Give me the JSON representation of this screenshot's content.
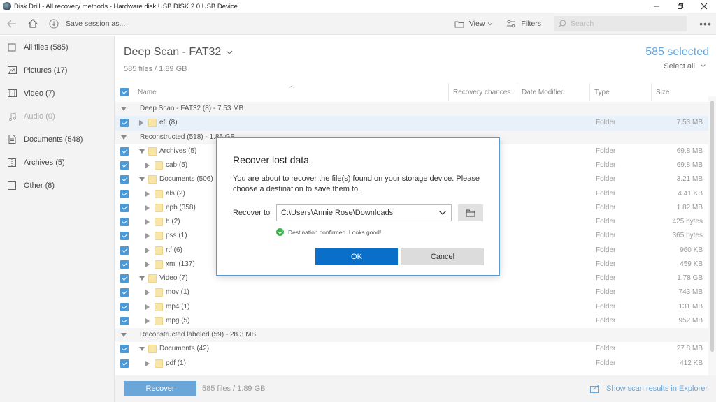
{
  "window": {
    "title": "Disk Drill - All recovery methods - Hardware disk USB DISK 2.0 USB Device",
    "controls": [
      "minimize",
      "maximize",
      "close"
    ]
  },
  "toolbar": {
    "save_session": "Save session as...",
    "view": "View",
    "filters": "Filters",
    "search_placeholder": "Search"
  },
  "sidebar": {
    "items": [
      {
        "label": "All files (585)",
        "icon": "file-icon",
        "state": "active"
      },
      {
        "label": "Pictures (17)",
        "icon": "picture-icon",
        "state": "normal"
      },
      {
        "label": "Video (7)",
        "icon": "video-icon",
        "state": "normal"
      },
      {
        "label": "Audio (0)",
        "icon": "audio-icon",
        "state": "disabled"
      },
      {
        "label": "Documents (548)",
        "icon": "document-icon",
        "state": "normal"
      },
      {
        "label": "Archives (5)",
        "icon": "archive-icon",
        "state": "normal"
      },
      {
        "label": "Other (8)",
        "icon": "other-icon",
        "state": "normal"
      }
    ]
  },
  "main": {
    "title": "Deep Scan - FAT32",
    "subtitle": "585 files / 1.89 GB",
    "selected": "585 selected",
    "select_all": "Select all"
  },
  "table": {
    "columns": [
      "Name",
      "Recovery chances",
      "Date Modified",
      "Type",
      "Size"
    ],
    "rows": [
      {
        "kind": "group",
        "name": "Deep Scan - FAT32 (8) - 7.53 MB"
      },
      {
        "kind": "item",
        "level": 1,
        "expander": "right",
        "name": "efi (8)",
        "type": "Folder",
        "size": "7.53 MB",
        "highlight": true
      },
      {
        "kind": "group",
        "name": "Reconstructed (518) - 1.85 GB"
      },
      {
        "kind": "item",
        "level": 1,
        "expander": "down",
        "name": "Archives (5)",
        "type": "Folder",
        "size": "69.8 MB"
      },
      {
        "kind": "item",
        "level": 2,
        "expander": "right",
        "name": "cab (5)",
        "type": "Folder",
        "size": "69.8 MB"
      },
      {
        "kind": "item",
        "level": 1,
        "expander": "down",
        "name": "Documents (506)",
        "type": "Folder",
        "size": "3.21 MB"
      },
      {
        "kind": "item",
        "level": 2,
        "expander": "right",
        "name": "als (2)",
        "type": "Folder",
        "size": "4.41 KB"
      },
      {
        "kind": "item",
        "level": 2,
        "expander": "right",
        "name": "epb (358)",
        "type": "Folder",
        "size": "1.82 MB"
      },
      {
        "kind": "item",
        "level": 2,
        "expander": "right",
        "name": "h (2)",
        "type": "Folder",
        "size": "425 bytes"
      },
      {
        "kind": "item",
        "level": 2,
        "expander": "right",
        "name": "pss (1)",
        "type": "Folder",
        "size": "365 bytes"
      },
      {
        "kind": "item",
        "level": 2,
        "expander": "right",
        "name": "rtf (6)",
        "type": "Folder",
        "size": "960 KB"
      },
      {
        "kind": "item",
        "level": 2,
        "expander": "right",
        "name": "xml (137)",
        "type": "Folder",
        "size": "459 KB"
      },
      {
        "kind": "item",
        "level": 1,
        "expander": "down",
        "name": "Video (7)",
        "type": "Folder",
        "size": "1.78 GB"
      },
      {
        "kind": "item",
        "level": 2,
        "expander": "right",
        "name": "mov (1)",
        "type": "Folder",
        "size": "743 MB"
      },
      {
        "kind": "item",
        "level": 2,
        "expander": "right",
        "name": "mp4 (1)",
        "type": "Folder",
        "size": "131 MB"
      },
      {
        "kind": "item",
        "level": 2,
        "expander": "right",
        "name": "mpg (5)",
        "type": "Folder",
        "size": "952 MB"
      },
      {
        "kind": "group",
        "name": "Reconstructed labeled (59) - 28.3 MB"
      },
      {
        "kind": "item",
        "level": 1,
        "expander": "down",
        "name": "Documents (42)",
        "type": "Folder",
        "size": "27.8 MB"
      },
      {
        "kind": "item",
        "level": 2,
        "expander": "right",
        "name": "pdf (1)",
        "type": "Folder",
        "size": "412 KB"
      }
    ]
  },
  "bottom": {
    "recover_label": "Recover",
    "info": "585 files / 1.89 GB",
    "explorer_link": "Show scan results in Explorer"
  },
  "dialog": {
    "title": "Recover lost data",
    "message": "You are about to recover the file(s) found on your storage device. Please choose a destination to save them to.",
    "recover_to_label": "Recover to",
    "path": "C:\\Users\\Annie Rose\\Downloads",
    "confirmation": "Destination confirmed. Looks good!",
    "ok_label": "OK",
    "cancel_label": "Cancel"
  },
  "colors": {
    "accent": "#6aa6d8",
    "ok_button": "#0a6fc9",
    "checkbox": "#4a9ad8",
    "success": "#3bb54a",
    "folder": "#f7e6a8"
  }
}
